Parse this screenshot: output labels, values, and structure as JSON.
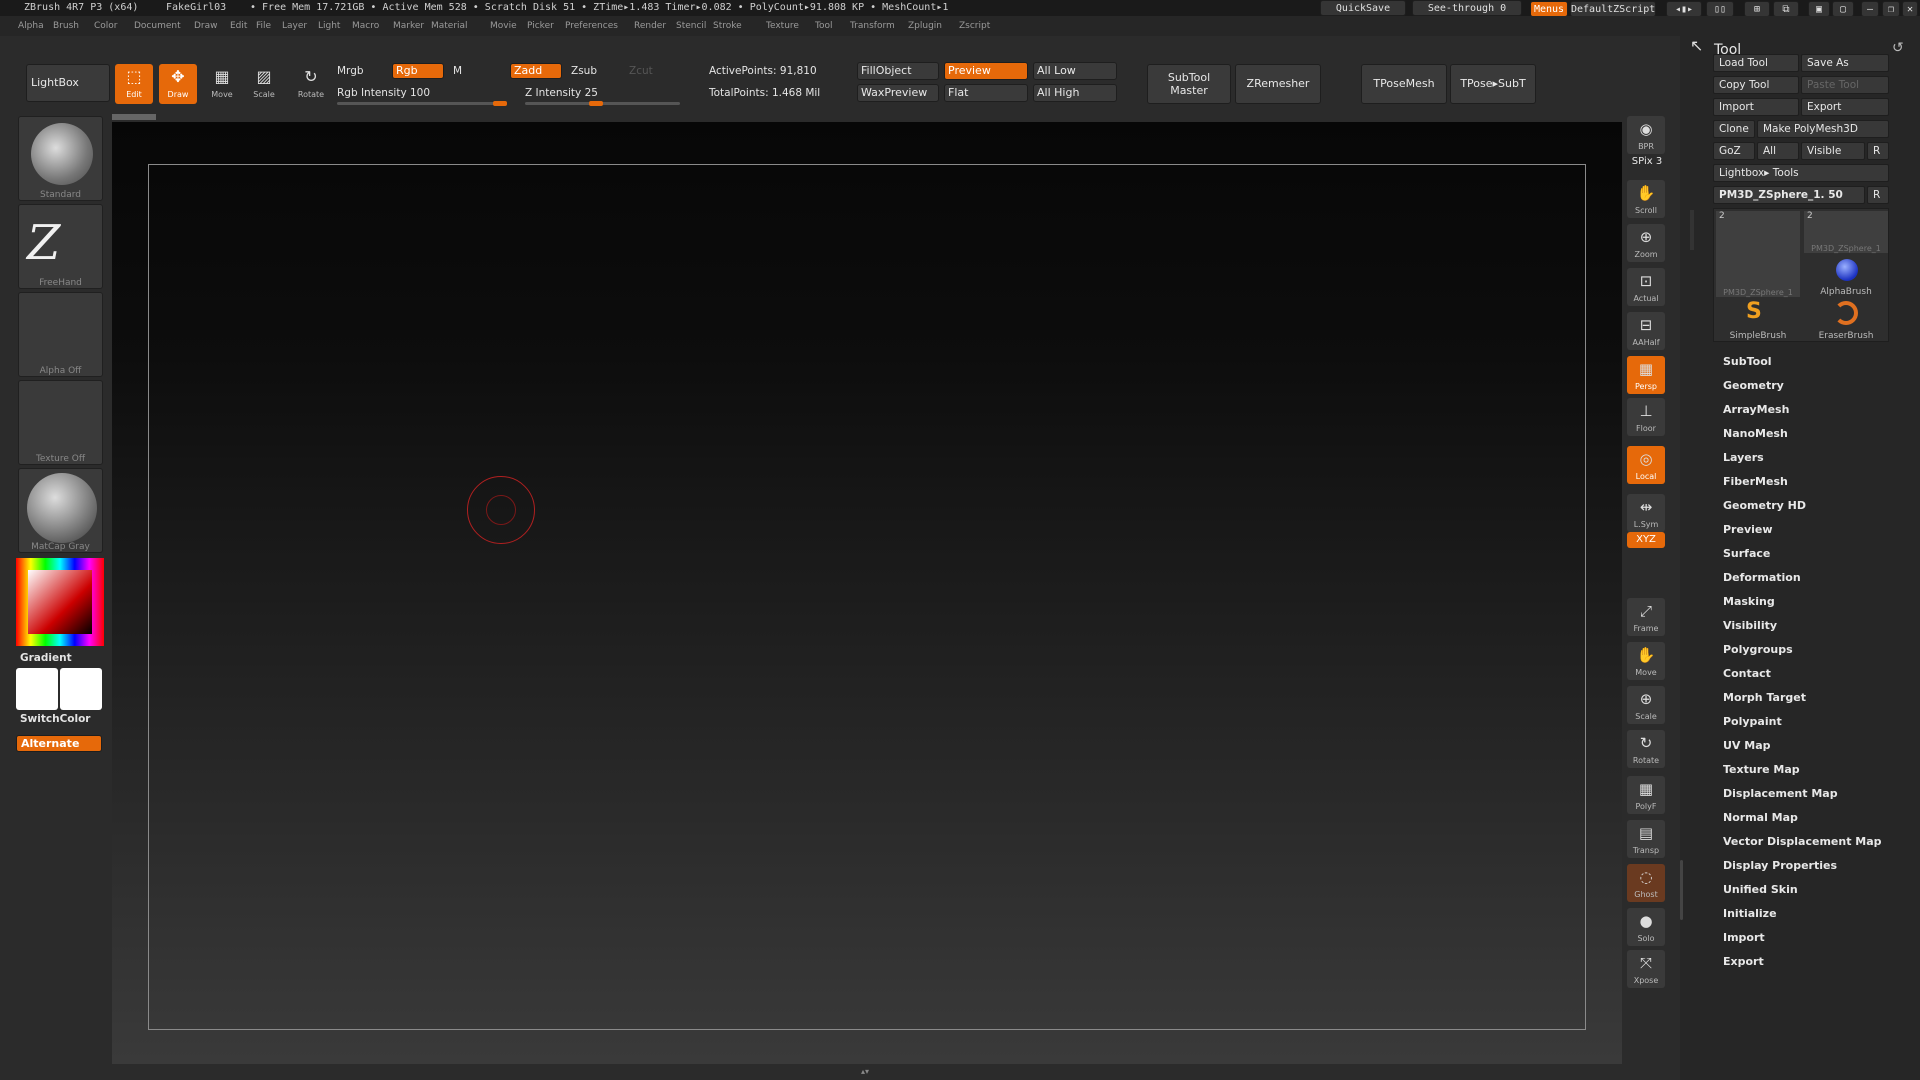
{
  "titlebar": {
    "app": "ZBrush 4R7 P3 (x64)",
    "doc": "FakeGirl03",
    "stats": "• Free Mem 17.721GB • Active Mem 528 • Scratch Disk 51 • ZTime▸1.483 Timer▸0.082 • PolyCount▸91.808 KP • MeshCount▸1",
    "quicksave": "QuickSave",
    "seethrough": "See-through 0",
    "menus": "Menus",
    "zscript": "DefaultZScript"
  },
  "menubar": [
    "Alpha",
    "Brush",
    "Color",
    "Document",
    "Draw",
    "Edit",
    "File",
    "Layer",
    "Light",
    "Macro",
    "Marker",
    "Material",
    "Movie",
    "Picker",
    "Preferences",
    "Render",
    "Stencil",
    "Stroke",
    "Texture",
    "Tool",
    "Transform",
    "Zplugin",
    "Zscript"
  ],
  "toolbar": {
    "lightbox": "LightBox",
    "edit": "Edit",
    "draw": "Draw",
    "move": "Move",
    "scale": "Scale",
    "rotate": "Rotate",
    "mrgb": "Mrgb",
    "rgb": "Rgb",
    "m": "M",
    "zadd": "Zadd",
    "zsub": "Zsub",
    "zcut": "Zcut",
    "rgb_intensity": "Rgb Intensity 100",
    "z_intensity": "Z Intensity 25",
    "active_points": "ActivePoints: 91,810",
    "total_points": "TotalPoints: 1.468 Mil",
    "fillobject": "FillObject",
    "preview": "Preview",
    "all_low": "All Low",
    "waxpreview": "WaxPreview",
    "flat": "Flat",
    "all_high": "All High",
    "subtool_master": "SubTool Master",
    "zremesher": "ZRemesher",
    "tposemesh": "TPoseMesh",
    "tposesubt": "TPose▸SubT"
  },
  "leftshelf": {
    "brush": "Standard",
    "stroke": "FreeHand",
    "alpha": "Alpha Off",
    "texture": "Texture Off",
    "material": "MatCap Gray",
    "gradient": "Gradient",
    "switchcolor": "SwitchColor",
    "alternate": "Alternate"
  },
  "rightshelf": [
    "BPR",
    "SPix 3",
    "Scroll",
    "Zoom",
    "Actual",
    "AAHalf",
    "Persp",
    "Floor",
    "Local",
    "L.Sym",
    "XYZ",
    "Frame",
    "Move",
    "Scale",
    "Rotate",
    "PolyF",
    "Transp",
    "Ghost",
    "Solo",
    "Xpose"
  ],
  "toolpanel": {
    "title": "Tool",
    "load_tool": "Load Tool",
    "save_as": "Save As",
    "copy_tool": "Copy Tool",
    "paste_tool": "Paste Tool",
    "import": "Import",
    "export": "Export",
    "clone": "Clone",
    "make_polymesh": "Make PolyMesh3D",
    "goz": "GoZ",
    "all": "All",
    "visible": "Visible",
    "r": "R",
    "lightbox_tools": "Lightbox▸ Tools",
    "current_tool": "PM3D_ZSphere_1. 50",
    "thumbs": [
      "PM3D_ZSphere_1",
      "PM3D_ZSphere_1",
      "AlphaBrush",
      "SimpleBrush",
      "EraserBrush"
    ],
    "subpalettes": [
      "SubTool",
      "Geometry",
      "ArrayMesh",
      "NanoMesh",
      "Layers",
      "FiberMesh",
      "Geometry HD",
      "Preview",
      "Surface",
      "Deformation",
      "Masking",
      "Visibility",
      "Polygroups",
      "Contact",
      "Morph Target",
      "Polypaint",
      "UV Map",
      "Texture Map",
      "Displacement Map",
      "Normal Map",
      "Vector Displacement Map",
      "Display Properties",
      "Unified Skin",
      "Initialize",
      "Import",
      "Export"
    ]
  },
  "colors": {
    "accent": "#e6690a",
    "panel": "#262626",
    "bg": "#2b2b2b"
  }
}
